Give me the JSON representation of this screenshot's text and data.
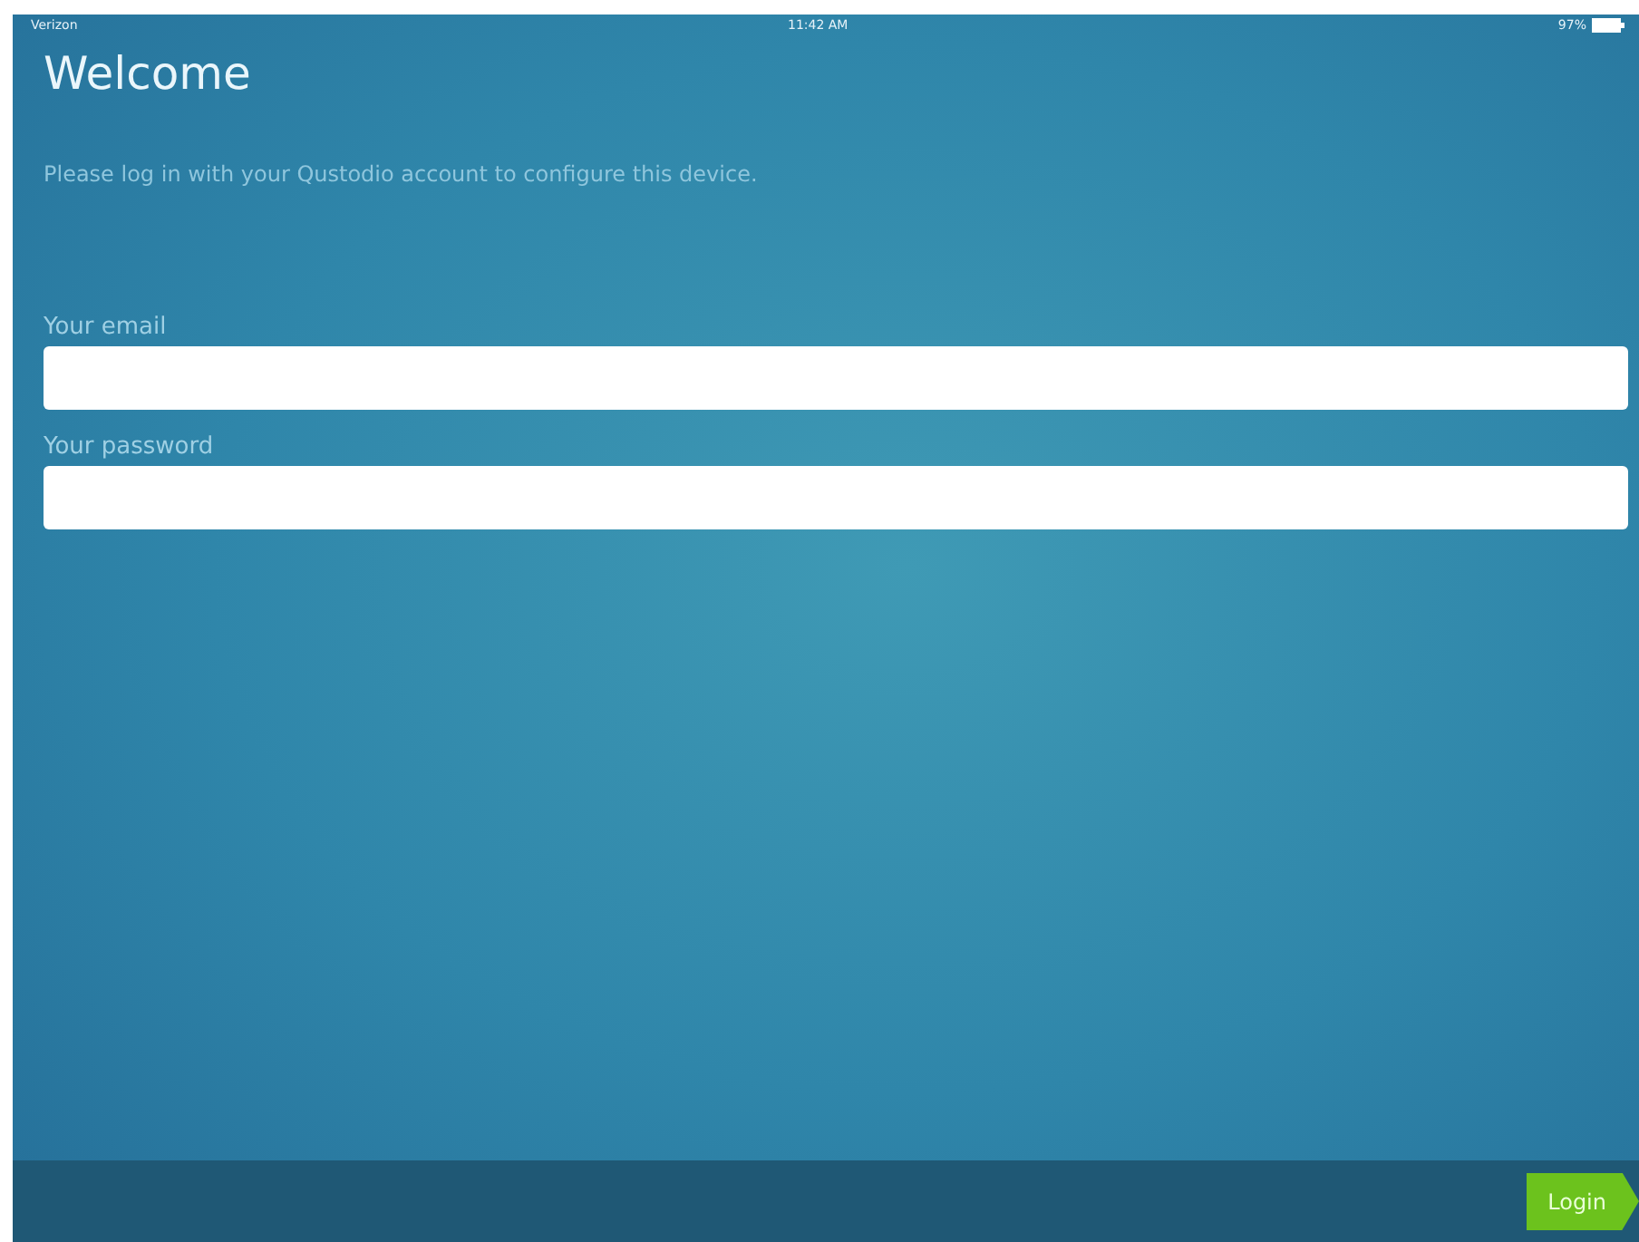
{
  "status_bar": {
    "carrier": "Verizon",
    "time": "11:42 AM",
    "battery": "97%"
  },
  "title": "Welcome",
  "subtitle": "Please log in with your Qustodio account to configure this device.",
  "fields": [
    {
      "label": "Your email"
    },
    {
      "label": "Your password"
    }
  ],
  "buttons": [
    "Login"
  ]
}
